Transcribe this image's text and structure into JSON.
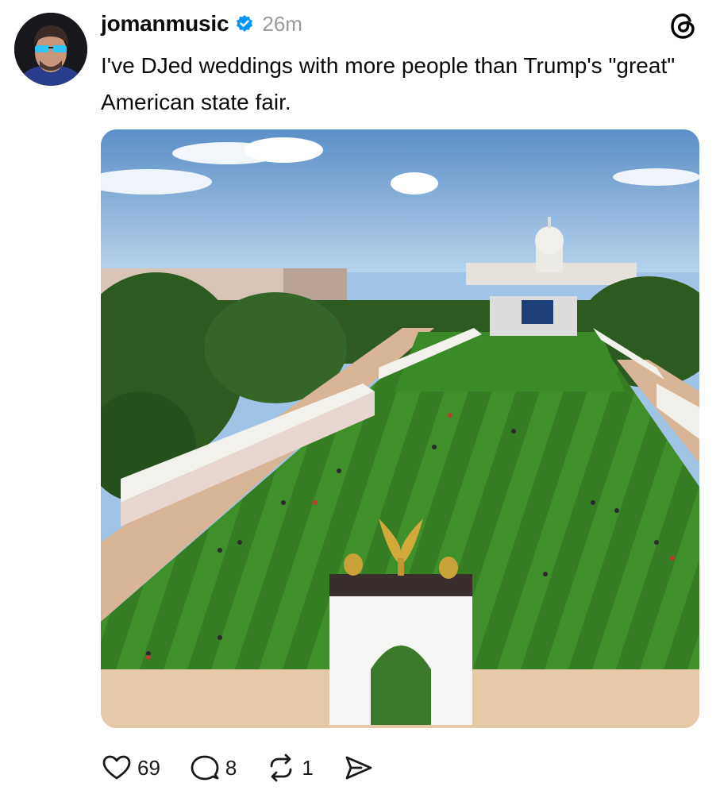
{
  "post": {
    "username": "jomanmusic",
    "verified_icon": "verified-badge-icon",
    "timestamp": "26m",
    "text": "I've DJed weddings with more people than Trump's \"great\" American state fair.",
    "platform_icon": "threads-logo-icon",
    "image_alt": "Aerial view of the National Mall with fair tents, a white arch topped with gold eagles, and the U.S. Capitol in the distance"
  },
  "actions": {
    "like_count": "69",
    "reply_count": "8",
    "repost_count": "1"
  },
  "colors": {
    "verified_blue": "#0095f6",
    "text": "#0a0a0a",
    "muted": "#9a9a9a"
  }
}
